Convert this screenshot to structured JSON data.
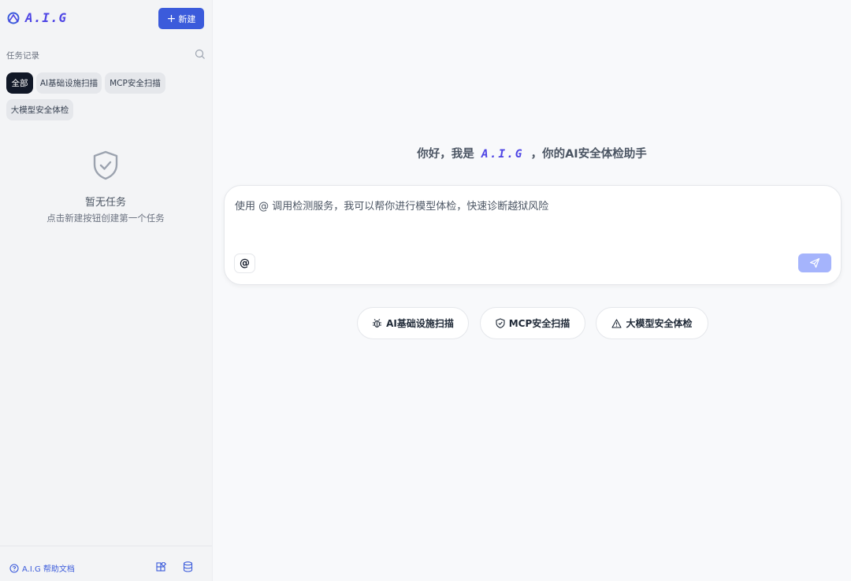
{
  "sidebar": {
    "logo_text": "A.I.G",
    "new_button": "新建",
    "section_title": "任务记录",
    "filters": [
      "全部",
      "AI基础设施扫描",
      "MCP安全扫描",
      "大模型安全体检"
    ],
    "empty": {
      "title": "暂无任务",
      "subtitle": "点击新建按钮创建第一个任务"
    },
    "footer": {
      "help_link": "A.I.G 帮助文档"
    }
  },
  "main": {
    "greeting_prefix": "你好，我是",
    "greeting_logo": "A.I.G",
    "greeting_suffix": "，你的AI安全体检助手",
    "input_placeholder": "使用 @ 调用检测服务，我可以帮你进行模型体检，快速诊断越狱风险",
    "at_label": "@",
    "quick_actions": [
      "AI基础设施扫描",
      "MCP安全扫描",
      "大模型安全体检"
    ]
  },
  "colors": {
    "accent": "#3b5bdb",
    "logo": "#4f46e5",
    "send_disabled": "#a5b4fc",
    "chip_active": "#111827"
  }
}
